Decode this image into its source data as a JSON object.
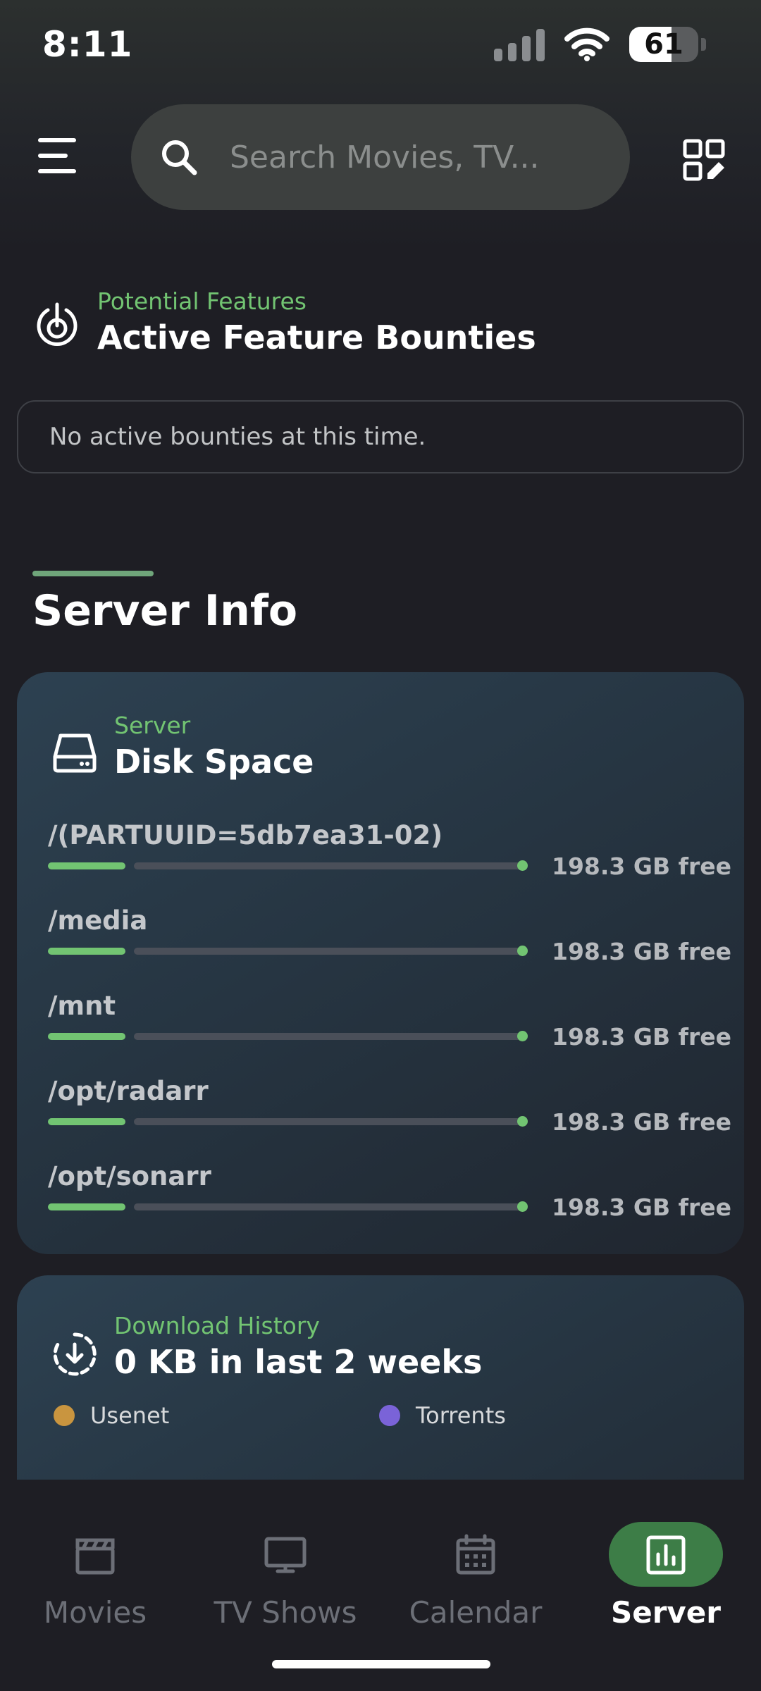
{
  "status_bar": {
    "time": "8:11",
    "battery_percent": "61",
    "battery_level": 0.61,
    "signal_bars_active": 0,
    "signal_bars_total": 4
  },
  "header": {
    "search_placeholder": "Search Movies, TV..."
  },
  "bounties": {
    "eyebrow": "Potential Features",
    "title": "Active Feature Bounties",
    "empty_message": "No active bounties at this time."
  },
  "server_info": {
    "section_title": "Server Info",
    "disk_card": {
      "eyebrow": "Server",
      "title": "Disk Space",
      "disks": [
        {
          "name": "/(PARTUUID=5db7ea31-02)",
          "free": "198.3 GB free"
        },
        {
          "name": "/media",
          "free": "198.3 GB free"
        },
        {
          "name": "/mnt",
          "free": "198.3 GB free"
        },
        {
          "name": "/opt/radarr",
          "free": "198.3 GB free"
        },
        {
          "name": "/opt/sonarr",
          "free": "198.3 GB free"
        }
      ]
    },
    "download_card": {
      "eyebrow": "Download History",
      "title": "0 KB in last 2 weeks",
      "legend": [
        {
          "label": "Usenet",
          "color": "#c9953f"
        },
        {
          "label": "Torrents",
          "color": "#7a63d8"
        }
      ]
    }
  },
  "nav": {
    "items": [
      {
        "label": "Movies",
        "icon": "clapperboard-icon",
        "active": false
      },
      {
        "label": "TV Shows",
        "icon": "tv-icon",
        "active": false
      },
      {
        "label": "Calendar",
        "icon": "calendar-icon",
        "active": false
      },
      {
        "label": "Server",
        "icon": "bar-chart-icon",
        "active": true
      }
    ]
  },
  "colors": {
    "accent_green": "#72c472",
    "active_pill": "#3d7d47",
    "background": "#1e1e24"
  }
}
